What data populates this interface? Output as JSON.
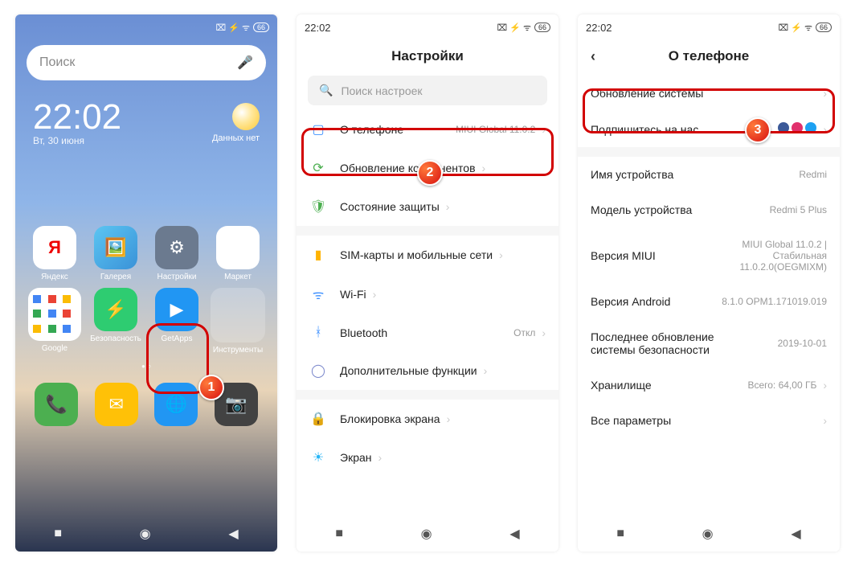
{
  "status": {
    "time": "22:02",
    "battery": "66"
  },
  "screen1": {
    "search": "Поиск",
    "clock": "22:02",
    "date": "Вт, 30 июня",
    "weather": "Данных нет",
    "apps": {
      "yandex": "Яндекс",
      "gallery": "Галерея",
      "settings": "Настройки",
      "market": "Маркет",
      "google": "Google",
      "security": "Безопасность",
      "getapps": "GetApps",
      "tools": "Инструменты"
    }
  },
  "screen2": {
    "title": "Настройки",
    "search": "Поиск настроек",
    "about": "О телефоне",
    "about_val": "MIUI Global 11.0.2",
    "updates": "Обновление компонентов",
    "protection": "Состояние защиты",
    "sim": "SIM-карты и мобильные сети",
    "wifi": "Wi-Fi",
    "bt": "Bluetooth",
    "bt_val": "Откл",
    "extra": "Дополнительные функции",
    "lock": "Блокировка экрана",
    "screen": "Экран"
  },
  "screen3": {
    "title": "О телефоне",
    "sysupdate": "Обновление системы",
    "follow": "Подпишитесь на нас",
    "devname": "Имя устройства",
    "devname_val": "Redmi",
    "model": "Модель устройства",
    "model_val": "Redmi 5 Plus",
    "miui": "Версия MIUI",
    "miui_val": "MIUI Global 11.0.2 | Стабильная 11.0.2.0(OEGMIXM)",
    "android": "Версия Android",
    "android_val": "8.1.0 OPM1.171019.019",
    "lastsec": "Последнее обновление системы безопасности",
    "lastsec_val": "2019-10-01",
    "storage": "Хранилище",
    "storage_val": "Всего: 64,00 ГБ",
    "allparams": "Все параметры"
  },
  "badges": {
    "b1": "1",
    "b2": "2",
    "b3": "3"
  }
}
